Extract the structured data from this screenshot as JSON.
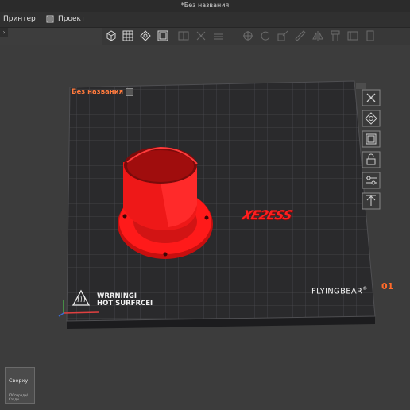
{
  "window": {
    "title": "*Без названия"
  },
  "menu": [
    {
      "label": "Принтер",
      "icon": "printer-icon"
    },
    {
      "label": "Проект",
      "icon": "project-icon"
    }
  ],
  "toolbar": {
    "buttons": [
      "add-object-icon",
      "arrange-grid-icon",
      "auto-orient-icon",
      "layout-icon",
      "split-icon",
      "cut-icon",
      "layers-icon",
      "move-icon",
      "rotate-icon",
      "scale-icon",
      "measure-icon",
      "mirror-icon",
      "support-icon",
      "seam-icon",
      "paint-icon"
    ]
  },
  "plate": {
    "name": "Без названия",
    "index": "01",
    "warning_line1": "WRRNINGI",
    "warning_line2": "HOT SURFRCEI",
    "brand": "FLYINGBEAR",
    "brand_mark": "®"
  },
  "model_text": "XE2ESS",
  "sidebar": [
    "delete-icon",
    "auto-orient-icon",
    "arrange-icon",
    "lock-icon",
    "settings-icon",
    "export-icon"
  ],
  "navcube": {
    "label": "Сверху",
    "sub": "ЮСпереди/Сзади"
  },
  "colors": {
    "accent": "#ff7a3d",
    "model": "#ff1a1a",
    "plate": "#2a2a2c"
  }
}
